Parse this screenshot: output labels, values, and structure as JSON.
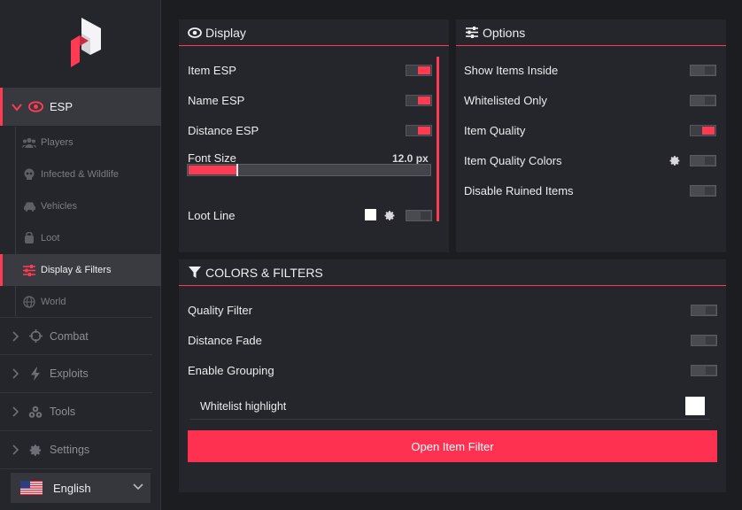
{
  "sidebar": {
    "esp_label": "ESP",
    "sub_items": [
      {
        "label": "Players",
        "icon": "players-icon"
      },
      {
        "label": "Infected & Wildlife",
        "icon": "skull-icon"
      },
      {
        "label": "Vehicles",
        "icon": "car-icon"
      },
      {
        "label": "Loot",
        "icon": "loot-icon"
      },
      {
        "label": "Display & Filters",
        "icon": "sliders-icon",
        "active": true
      },
      {
        "label": "World",
        "icon": "globe-icon"
      }
    ],
    "main_items": [
      {
        "label": "Combat",
        "icon": "crosshair-icon"
      },
      {
        "label": "Exploits",
        "icon": "bolt-icon"
      },
      {
        "label": "Tools",
        "icon": "tools-icon"
      },
      {
        "label": "Settings",
        "icon": "gear-icon"
      }
    ],
    "language": "English"
  },
  "display": {
    "title": "Display",
    "item_esp": {
      "label": "Item ESP",
      "on": true
    },
    "name_esp": {
      "label": "Name ESP",
      "on": true
    },
    "distance_esp": {
      "label": "Distance ESP",
      "on": true
    },
    "font_size": {
      "label": "Font Size",
      "value_text": "12.0 px",
      "fraction": 0.2
    },
    "loot_line": {
      "label": "Loot Line",
      "on": false,
      "color": "#ffffff"
    }
  },
  "options": {
    "title": "Options",
    "rows": [
      {
        "label": "Show Items Inside",
        "on": false
      },
      {
        "label": "Whitelisted Only",
        "on": false
      },
      {
        "label": "Item Quality",
        "on": true
      },
      {
        "label": "Item Quality Colors",
        "on": false,
        "has_gear": true
      },
      {
        "label": "Disable Ruined Items",
        "on": false
      }
    ]
  },
  "colors_filters": {
    "title": "COLORS & FILTERS",
    "rows": [
      {
        "label": "Quality Filter",
        "on": false
      },
      {
        "label": "Distance Fade",
        "on": false
      },
      {
        "label": "Enable Grouping",
        "on": false
      }
    ],
    "whitelist_highlight": {
      "label": "Whitelist highlight",
      "color": "#ffffff"
    },
    "open_filter_button": "Open Item Filter"
  },
  "colors": {
    "accent": "#ff3b54",
    "panel": "#25262b",
    "background": "#1c1d21"
  }
}
